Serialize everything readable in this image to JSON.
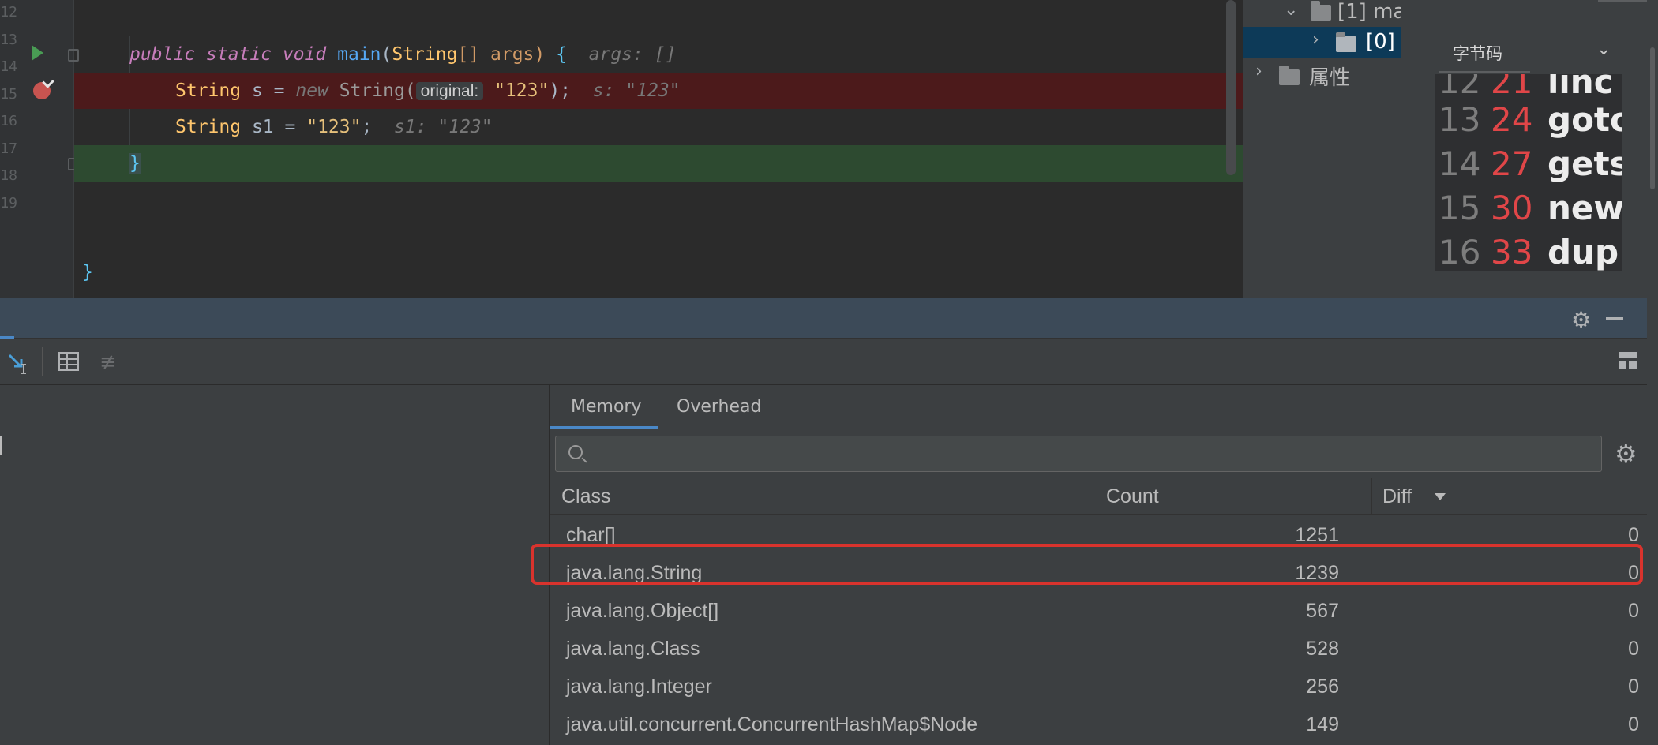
{
  "editor": {
    "lines": [
      {
        "number": "12"
      },
      {
        "number": "13"
      },
      {
        "number": "14"
      },
      {
        "number": "15"
      },
      {
        "number": "16"
      },
      {
        "number": "17"
      },
      {
        "number": "18"
      },
      {
        "number": "19"
      }
    ],
    "code": {
      "l13_mods": "public static void ",
      "l13_name": "main",
      "l13_open": "(",
      "l13_type": "String",
      "l13_args": "[] args) ",
      "l13_brace": "{",
      "l13_hint": "args: []",
      "l14_type": "String",
      "l14_var": " s = ",
      "l14_new": "new ",
      "l14_cls": "String(",
      "l14_param": "original:",
      "l14_str": "\"123\"",
      "l14_end": ");",
      "l14_hint": "s: \"123\"",
      "l15_type": "String",
      "l15_var": " s1 = ",
      "l15_str": "\"123\"",
      "l15_end": ";",
      "l15_hint": "s1: \"123\"",
      "l16_brace": "}",
      "l19_brace": "}"
    }
  },
  "structure_tree": {
    "row_main": "[1] ma",
    "row_0": "[0] (",
    "row_attr": "属性"
  },
  "bytecode_panel": {
    "tab_label": "字节码",
    "rows": [
      {
        "line": "12",
        "offset": "21",
        "op": "linc"
      },
      {
        "line": "13",
        "offset": "24",
        "op": "goto"
      },
      {
        "line": "14",
        "offset": "27",
        "op": "gets"
      },
      {
        "line": "15",
        "offset": "30",
        "op": "new"
      },
      {
        "line": "16",
        "offset": "33",
        "op": "dup"
      }
    ]
  },
  "memory": {
    "tabs": [
      {
        "label": "Memory",
        "active": true
      },
      {
        "label": "Overhead",
        "active": false
      }
    ],
    "search": {
      "value": "",
      "placeholder": ""
    },
    "columns": {
      "class": "Class",
      "count": "Count",
      "diff": "Diff"
    },
    "sort": {
      "column": "Diff",
      "direction": "descending"
    },
    "rows": [
      {
        "class": "char[]",
        "count": "1251",
        "diff": "0"
      },
      {
        "class": "java.lang.String",
        "count": "1239",
        "diff": "0",
        "highlighted": true
      },
      {
        "class": "java.lang.Object[]",
        "count": "567",
        "diff": "0"
      },
      {
        "class": "java.lang.Class",
        "count": "528",
        "diff": "0"
      },
      {
        "class": "java.lang.Integer",
        "count": "256",
        "diff": "0"
      },
      {
        "class": "java.util.concurrent.ConcurrentHashMap$Node",
        "count": "149",
        "diff": "0"
      }
    ]
  },
  "icons": {
    "run": "run-gutter-icon",
    "breakpoint": "breakpoint-icon",
    "settings": "gear-icon",
    "minimize": "minimize-icon",
    "search": "search-icon",
    "table": "table-icon",
    "filter": "filter-icon",
    "layout": "layout-icon",
    "step": "step-into-icon"
  },
  "colors": {
    "breakpoint_line": "#4c1a1b",
    "current_line": "#2d4a30",
    "highlight_box": "#d9332d",
    "active_tab": "#4a88c7"
  }
}
